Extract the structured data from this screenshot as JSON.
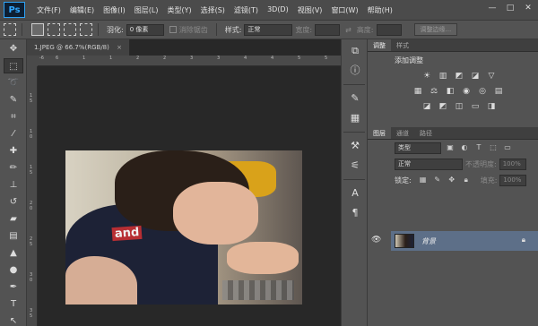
{
  "app": {
    "logo": "Ps"
  },
  "menu": [
    "文件(F)",
    "编辑(E)",
    "图像(I)",
    "图层(L)",
    "类型(Y)",
    "选择(S)",
    "滤镜(T)",
    "3D(D)",
    "视图(V)",
    "窗口(W)",
    "帮助(H)"
  ],
  "window_controls": [
    "—",
    "□",
    "✕"
  ],
  "options": {
    "feather_label": "羽化:",
    "feather_value": "0 像素",
    "antialias_label": "消除锯齿",
    "style_label": "样式:",
    "style_value": "正常",
    "width_label": "宽度:",
    "height_label": "高度:",
    "refine_button": "调整边缘..."
  },
  "document": {
    "tab_title": "1.JPEG @ 66.7%(RGB/8)",
    "tab_close": "×",
    "ruler_ticks_h": [
      "-6",
      "6",
      "1",
      "1",
      "2",
      "2",
      "3",
      "3",
      "4",
      "4",
      "5",
      "5"
    ],
    "ruler_ticks_v": [
      "1",
      "5",
      "1",
      "0",
      "1",
      "5",
      "2",
      "0",
      "2",
      "5",
      "3",
      "0",
      "3",
      "5"
    ],
    "photo_text": "and"
  },
  "tools": [
    "move",
    "marquee",
    "lasso",
    "quick-select",
    "crop",
    "eyedropper",
    "healing",
    "brush",
    "clone-stamp",
    "history-brush",
    "eraser",
    "gradient",
    "blur",
    "dodge",
    "pen",
    "type",
    "path-select"
  ],
  "adjust_panel": {
    "tabs": [
      "调整",
      "样式"
    ],
    "title": "添加调整"
  },
  "layers_panel": {
    "tabs": [
      "图层",
      "通道",
      "路径"
    ],
    "filter_label": "类型",
    "blend_mode": "正常",
    "opacity_label": "不透明度:",
    "opacity_value": "100%",
    "lock_label": "锁定:",
    "fill_label": "填充:",
    "fill_value": "100%",
    "layer_name": "背景"
  }
}
